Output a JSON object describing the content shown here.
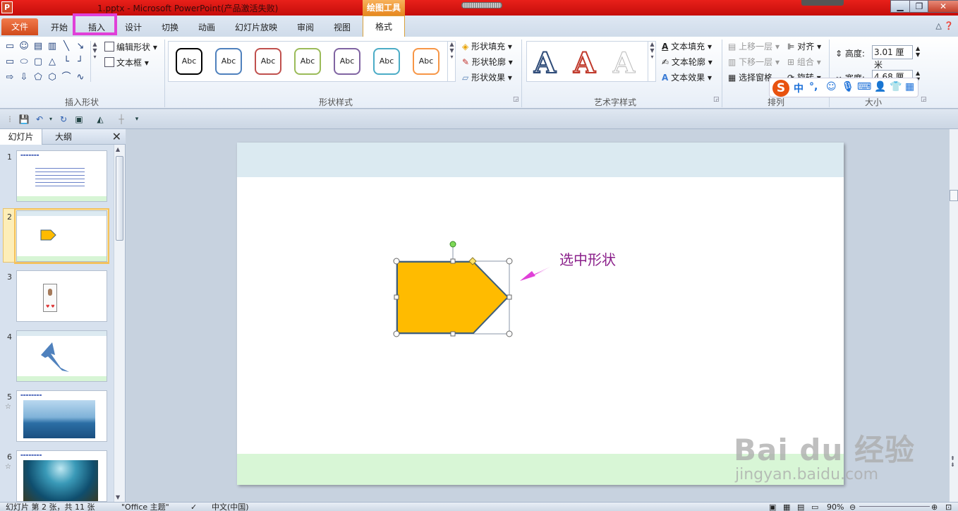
{
  "window": {
    "title": "1.pptx - Microsoft PowerPoint(产品激活失败)",
    "context_tab_group": "绘图工具",
    "app_icon_letter": "P"
  },
  "tabs": {
    "file": "文件",
    "items": [
      "开始",
      "插入",
      "设计",
      "切换",
      "动画",
      "幻灯片放映",
      "审阅",
      "视图"
    ],
    "format": "格式",
    "highlighted": "插入"
  },
  "ribbon": {
    "insert_shapes": {
      "label": "插入形状",
      "edit_shape": "编辑形状",
      "text_box": "文本框"
    },
    "shape_styles": {
      "label": "形状样式",
      "sample_text": "Abc",
      "swatch_colors": [
        "#000000",
        "#4f81bd",
        "#c0504d",
        "#9bbb59",
        "#8064a2",
        "#4bacc6",
        "#f79646"
      ],
      "fill": "形状填充",
      "outline": "形状轮廓",
      "effects": "形状效果"
    },
    "wordart": {
      "label": "艺术字样式",
      "glyph": "A",
      "text_fill": "文本填充",
      "text_outline": "文本轮廓",
      "text_effects": "文本效果"
    },
    "arrange": {
      "label": "排列",
      "bring_forward": "上移一层",
      "send_backward": "下移一层",
      "selection_pane": "选择窗格",
      "align": "对齐",
      "group": "组合",
      "rotate": "旋转"
    },
    "size": {
      "label": "大小",
      "height_label": "高度:",
      "height_value": "3.01 厘米",
      "width_label": "宽度:",
      "width_value": "4.68 厘米"
    }
  },
  "ime": {
    "logo": "S",
    "mode": "中"
  },
  "left_pane": {
    "tab_slides": "幻灯片",
    "tab_outline": "大纲",
    "close": "✕",
    "slides": [
      {
        "num": "1",
        "star": ""
      },
      {
        "num": "2",
        "star": ""
      },
      {
        "num": "3",
        "star": ""
      },
      {
        "num": "4",
        "star": ""
      },
      {
        "num": "5",
        "star": "☆"
      },
      {
        "num": "6",
        "star": "☆"
      }
    ],
    "selected_slide": 2
  },
  "slide": {
    "annotation": "选中形状",
    "shape_fill": "#ffbb00",
    "shape_outline": "#3f5f7a"
  },
  "status": {
    "slide_info": "幻灯片 第 2 张，共 11 张",
    "theme": "\"Office 主题\"",
    "language": "中文(中国)",
    "zoom": "90%"
  },
  "watermark": {
    "brand": "Bai du 经验",
    "url": "jingyan.baidu.com"
  }
}
